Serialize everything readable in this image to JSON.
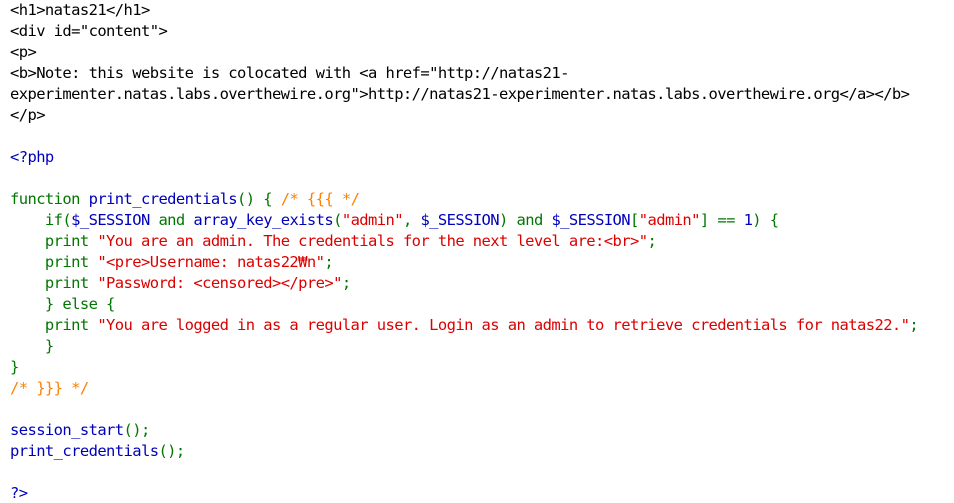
{
  "source": {
    "colors": {
      "html": "#000000",
      "php": "#0000BB",
      "keyword": "#007700",
      "string": "#DD0000",
      "comment": "#FF8000"
    },
    "lines": [
      [
        {
          "t": "<h1>natas21</h1>",
          "c": "html"
        }
      ],
      [
        {
          "t": "<div id=\"content\">",
          "c": "html"
        }
      ],
      [
        {
          "t": "<p>",
          "c": "html"
        }
      ],
      [
        {
          "t": "<b>Note: this website is colocated with <a href=\"http://natas21-",
          "c": "html"
        }
      ],
      [
        {
          "t": "experimenter.natas.labs.overthewire.org\">http://natas21-experimenter.natas.labs.overthewire.org</a></b>",
          "c": "html"
        }
      ],
      [
        {
          "t": "</p>",
          "c": "html"
        }
      ],
      [],
      [
        {
          "t": "<?php",
          "c": "php"
        }
      ],
      [],
      [
        {
          "t": "function ",
          "c": "kw"
        },
        {
          "t": "print_credentials",
          "c": "php"
        },
        {
          "t": "() { ",
          "c": "kw"
        },
        {
          "t": "/* {{{ */",
          "c": "cmt"
        }
      ],
      [
        {
          "t": "    if(",
          "c": "kw"
        },
        {
          "t": "$_SESSION ",
          "c": "php"
        },
        {
          "t": "and ",
          "c": "kw"
        },
        {
          "t": "array_key_exists",
          "c": "php"
        },
        {
          "t": "(",
          "c": "kw"
        },
        {
          "t": "\"admin\"",
          "c": "str"
        },
        {
          "t": ", ",
          "c": "kw"
        },
        {
          "t": "$_SESSION",
          "c": "php"
        },
        {
          "t": ") and ",
          "c": "kw"
        },
        {
          "t": "$_SESSION",
          "c": "php"
        },
        {
          "t": "[",
          "c": "kw"
        },
        {
          "t": "\"admin\"",
          "c": "str"
        },
        {
          "t": "] == ",
          "c": "kw"
        },
        {
          "t": "1",
          "c": "php"
        },
        {
          "t": ") {",
          "c": "kw"
        }
      ],
      [
        {
          "t": "    print ",
          "c": "kw"
        },
        {
          "t": "\"You are an admin. The credentials for the next level are:<br>\"",
          "c": "str"
        },
        {
          "t": ";",
          "c": "kw"
        }
      ],
      [
        {
          "t": "    print ",
          "c": "kw"
        },
        {
          "t": "\"<pre>Username: natas22₩n\"",
          "c": "str"
        },
        {
          "t": ";",
          "c": "kw"
        }
      ],
      [
        {
          "t": "    print ",
          "c": "kw"
        },
        {
          "t": "\"Password: <censored></pre>\"",
          "c": "str"
        },
        {
          "t": ";",
          "c": "kw"
        }
      ],
      [
        {
          "t": "    } else {",
          "c": "kw"
        }
      ],
      [
        {
          "t": "    print ",
          "c": "kw"
        },
        {
          "t": "\"You are logged in as a regular user. Login as an admin to retrieve credentials for natas22.\"",
          "c": "str"
        },
        {
          "t": ";",
          "c": "kw"
        }
      ],
      [
        {
          "t": "    }",
          "c": "kw"
        }
      ],
      [
        {
          "t": "}",
          "c": "kw"
        }
      ],
      [
        {
          "t": "/* }}} */",
          "c": "cmt"
        }
      ],
      [],
      [
        {
          "t": "session_start",
          "c": "php"
        },
        {
          "t": "();",
          "c": "kw"
        }
      ],
      [
        {
          "t": "print_credentials",
          "c": "php"
        },
        {
          "t": "();",
          "c": "kw"
        }
      ],
      [],
      [
        {
          "t": "?>",
          "c": "php"
        }
      ]
    ]
  }
}
